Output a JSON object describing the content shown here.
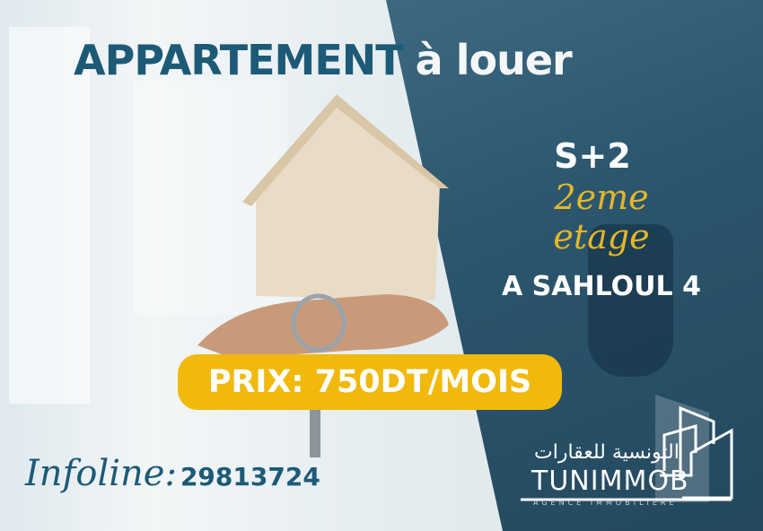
{
  "title": {
    "part1": "APPARTEMENT",
    "part2": "à louer"
  },
  "details": {
    "type": "S+2",
    "floor": "2eme etage",
    "location": "A SAHLOUL 4"
  },
  "price": "PRIX: 750DT/MOIS",
  "contact": {
    "label": "Infoline:",
    "phone": "29813724"
  },
  "brand": {
    "arabic": "التونسية للعقارات",
    "name": "TUNIMMOB",
    "tagline": "AGENCE IMMOBILIERE"
  },
  "colors": {
    "teal": "#1d5a78",
    "yellow": "#f0b90b",
    "overlay": "#245069"
  }
}
